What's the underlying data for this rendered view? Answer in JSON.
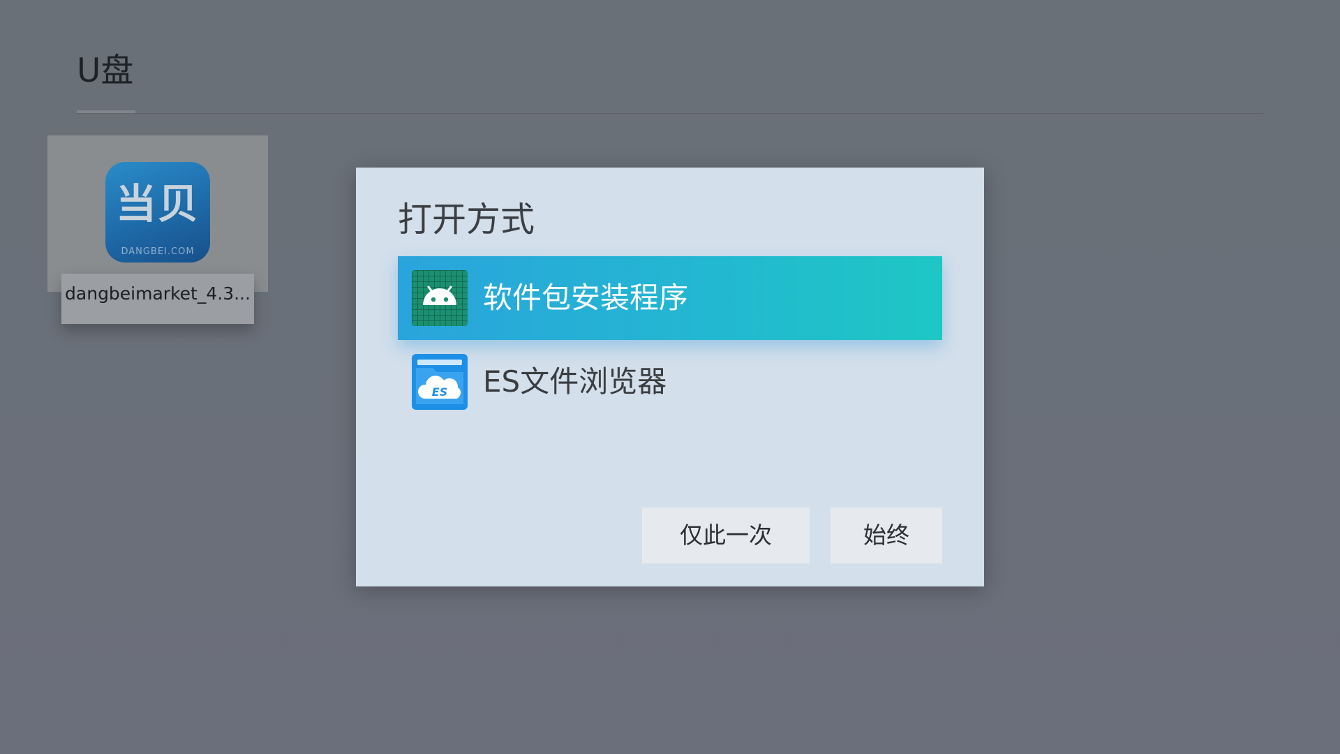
{
  "header": {
    "title": "U盘"
  },
  "files": [
    {
      "name": "dangbeimarket_4.3...",
      "icon": "dangbei-app-icon",
      "icon_text": "当贝",
      "icon_subtext": "DANGBEI.COM"
    }
  ],
  "dialog": {
    "title": "打开方式",
    "options": [
      {
        "label": "软件包安装程序",
        "icon": "android-package-installer-icon",
        "selected": true
      },
      {
        "label": "ES文件浏览器",
        "icon": "es-file-explorer-icon",
        "selected": false
      }
    ],
    "buttons": {
      "once": "仅此一次",
      "always": "始终"
    }
  },
  "colors": {
    "selection_start": "#2aa4dc",
    "selection_end": "#1ec7c4",
    "dialog_background": "#d3dfeb",
    "overlay_background": "#6a7079"
  }
}
